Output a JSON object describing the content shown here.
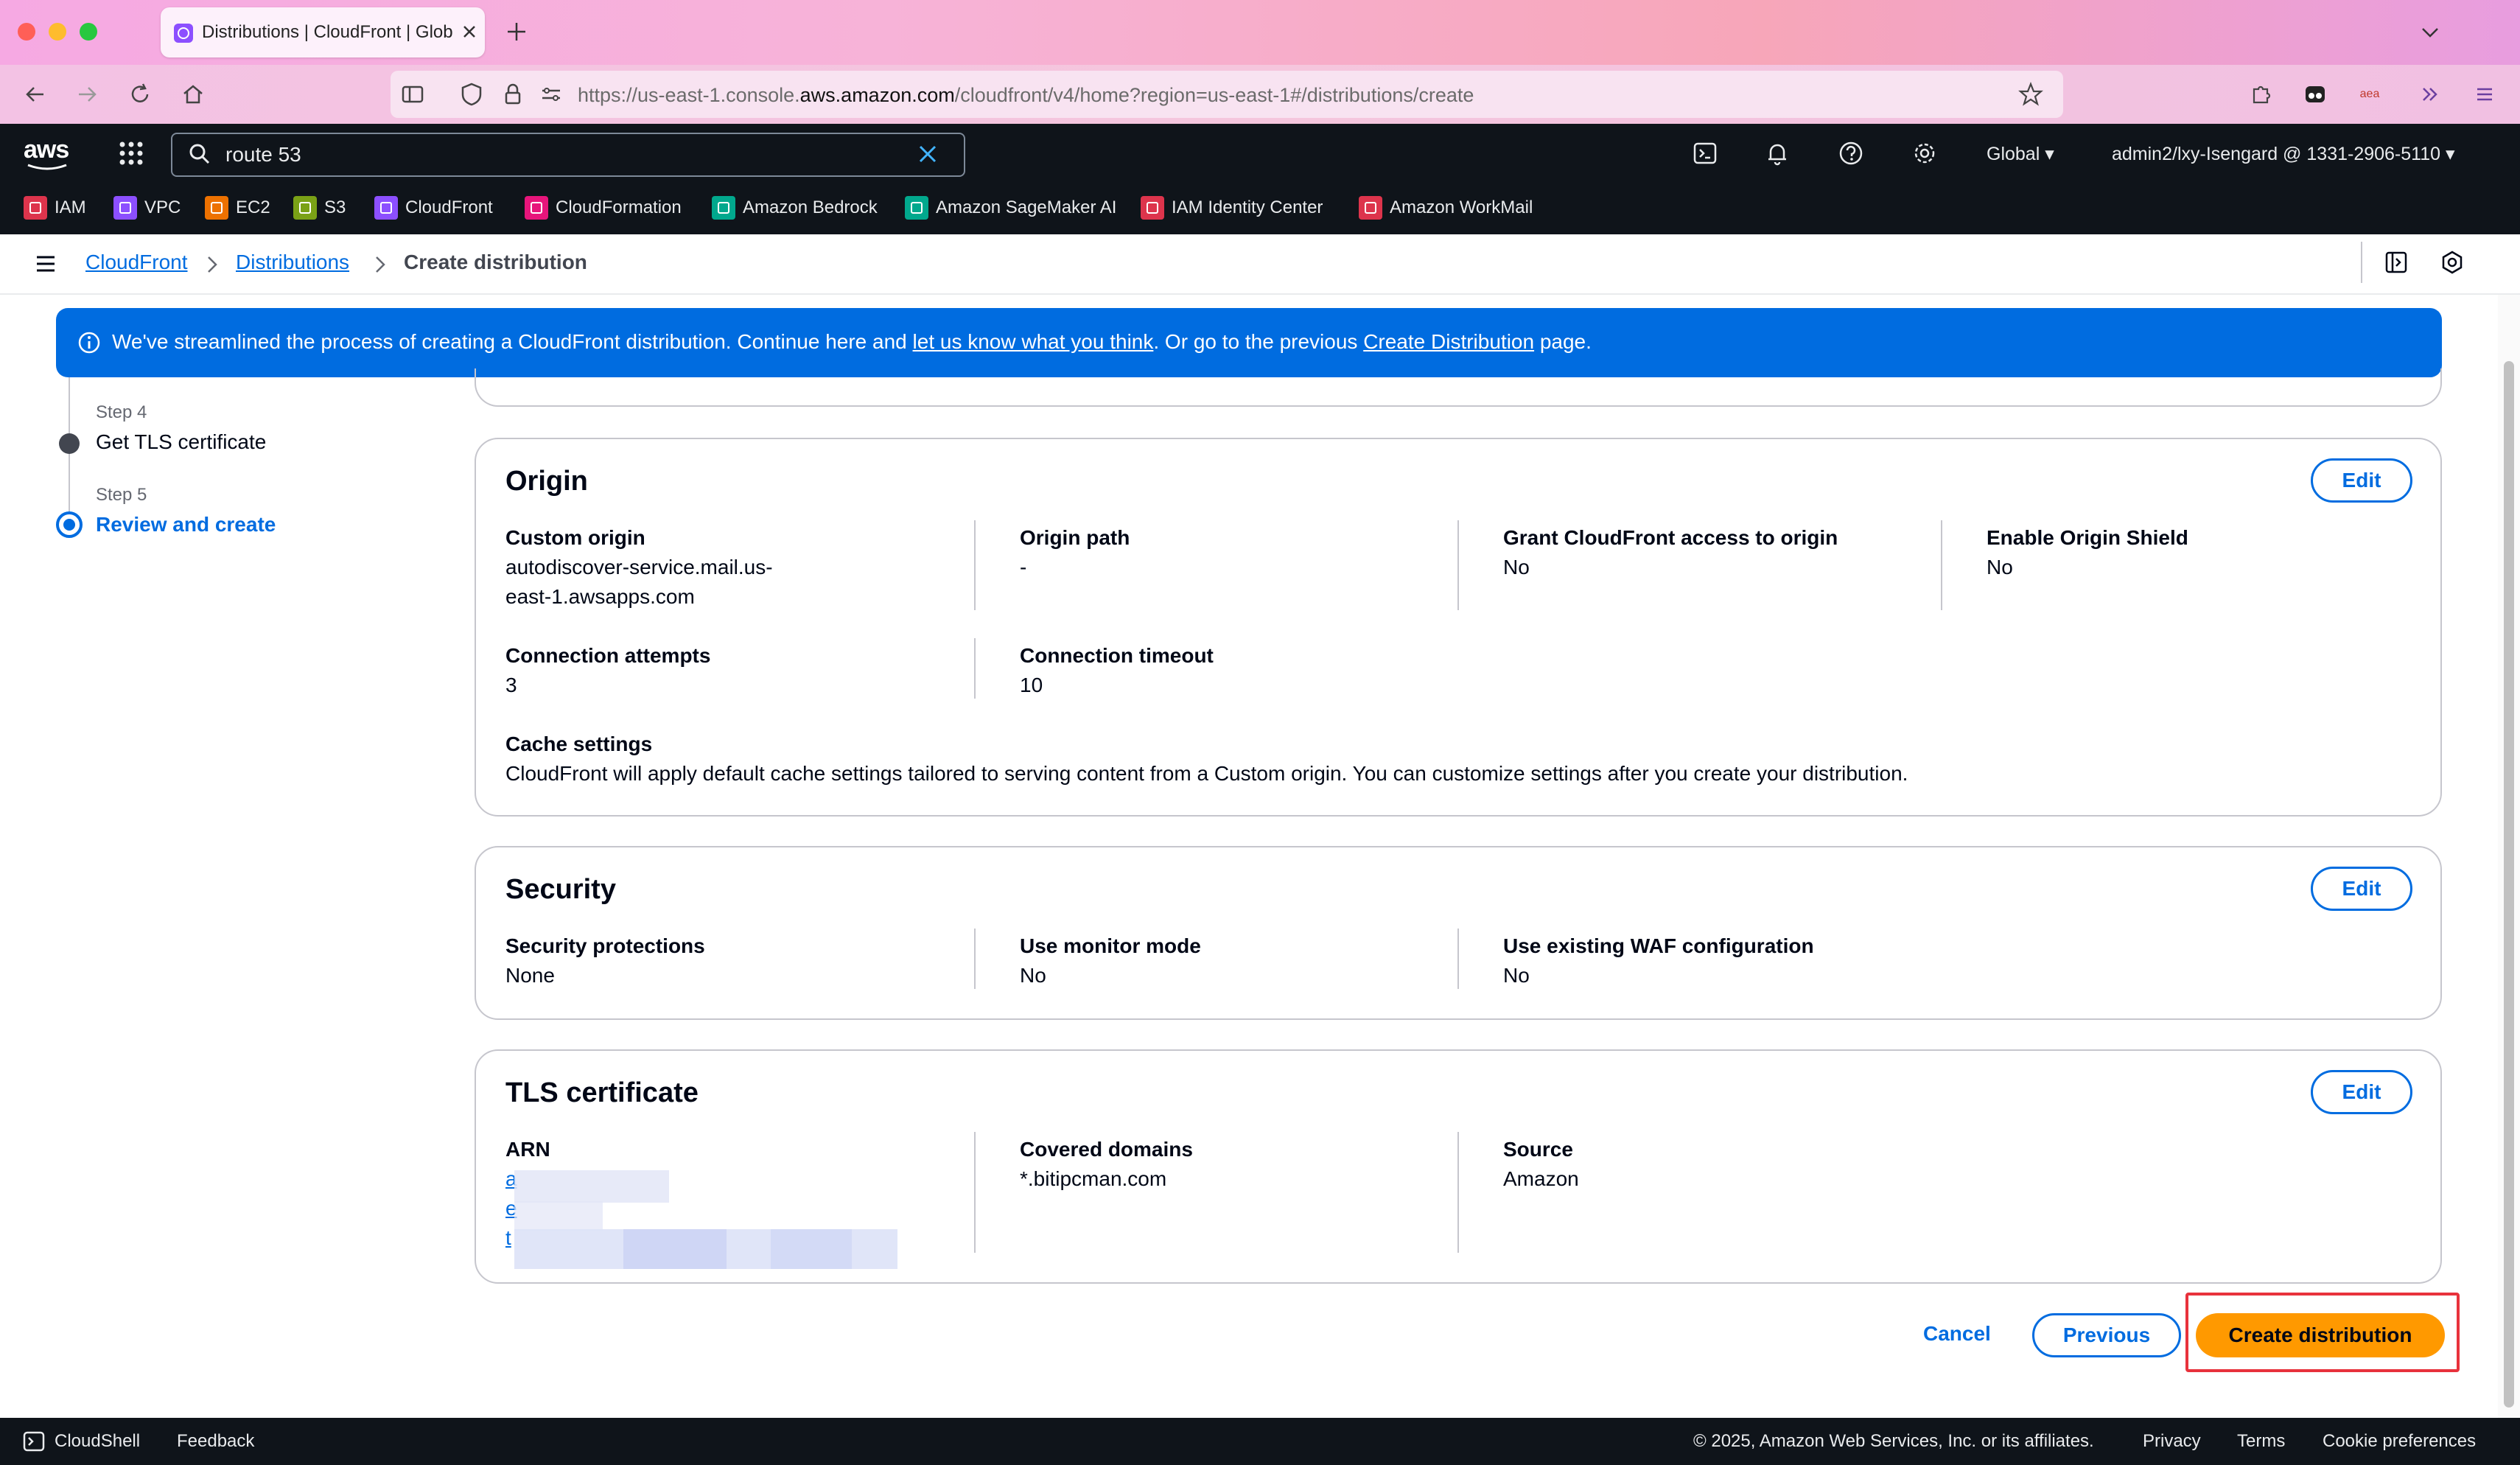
{
  "browser": {
    "tab_title": "Distributions | CloudFront | Glob",
    "url_prefix": "https://us-east-1.console.",
    "url_domain": "aws.amazon.com",
    "url_suffix": "/cloudfront/v4/home?region=us-east-1#/distributions/create",
    "extension_badge": "aea"
  },
  "console": {
    "logo": "aws",
    "search_value": "route 53",
    "region": "Global",
    "account": "admin2/lxy-Isengard @ 1331-2906-5110",
    "favorites": [
      {
        "label": "IAM",
        "color": "#dd344c"
      },
      {
        "label": "VPC",
        "color": "#8c4fff"
      },
      {
        "label": "EC2",
        "color": "#ed7100"
      },
      {
        "label": "S3",
        "color": "#7aa116"
      },
      {
        "label": "CloudFront",
        "color": "#8c4fff"
      },
      {
        "label": "CloudFormation",
        "color": "#e7157b"
      },
      {
        "label": "Amazon Bedrock",
        "color": "#01a88d"
      },
      {
        "label": "Amazon SageMaker AI",
        "color": "#01a88d"
      },
      {
        "label": "IAM Identity Center",
        "color": "#dd344c"
      },
      {
        "label": "Amazon WorkMail",
        "color": "#dd344c"
      }
    ]
  },
  "breadcrumb": {
    "items": [
      "CloudFront",
      "Distributions",
      "Create distribution"
    ]
  },
  "flash": {
    "text_1": "We've streamlined the process of creating a CloudFront distribution. Continue here and ",
    "link_1": "let us know what you think",
    "text_2": ". Or go to the previous ",
    "link_2": "Create Distribution",
    "text_3": " page."
  },
  "steps": [
    {
      "label": "Step 4",
      "title": "Get TLS certificate"
    },
    {
      "label": "Step 5",
      "title": "Review and create"
    }
  ],
  "origin": {
    "title": "Origin",
    "edit": "Edit",
    "custom_origin_label": "Custom origin",
    "custom_origin_value_1": "autodiscover-service.mail.us-",
    "custom_origin_value_2": "east-1.awsapps.com",
    "origin_path_label": "Origin path",
    "origin_path_value": "-",
    "grant_label": "Grant CloudFront access to origin",
    "grant_value": "No",
    "shield_label": "Enable Origin Shield",
    "shield_value": "No",
    "attempts_label": "Connection attempts",
    "attempts_value": "3",
    "timeout_label": "Connection timeout",
    "timeout_value": "10",
    "cache_label": "Cache settings",
    "cache_value": "CloudFront will apply default cache settings tailored to serving content from a Custom origin. You can customize settings after you create your distribution."
  },
  "security": {
    "title": "Security",
    "edit": "Edit",
    "protections_label": "Security protections",
    "protections_value": "None",
    "monitor_label": "Use monitor mode",
    "monitor_value": "No",
    "waf_label": "Use existing WAF configuration",
    "waf_value": "No"
  },
  "tls": {
    "title": "TLS certificate",
    "edit": "Edit",
    "arn_label": "ARN",
    "arn_line_1": "a",
    "arn_line_2": "e",
    "arn_line_3": "t",
    "domains_label": "Covered domains",
    "domains_value": "*.bitipcman.com",
    "source_label": "Source",
    "source_value": "Amazon"
  },
  "actions": {
    "cancel": "Cancel",
    "previous": "Previous",
    "create": "Create distribution",
    "highlight_color": "#e8323c"
  },
  "footer": {
    "cloudshell": "CloudShell",
    "feedback": "Feedback",
    "copyright": "© 2025, Amazon Web Services, Inc. or its affiliates.",
    "privacy": "Privacy",
    "terms": "Terms",
    "cookies": "Cookie preferences"
  }
}
